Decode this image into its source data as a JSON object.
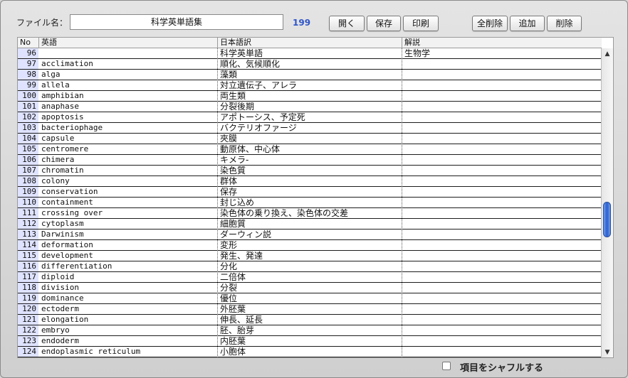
{
  "toolbar": {
    "file_label": "ファイル名：",
    "file_name": "科学英単語集",
    "count": "199",
    "open_label": "開く",
    "save_label": "保存",
    "print_label": "印刷",
    "delete_all_label": "全削除",
    "add_label": "追加",
    "delete_label": "削除"
  },
  "table": {
    "headers": {
      "no": "No",
      "en": "英語",
      "ja": "日本語訳",
      "ex": "解説"
    },
    "rows": [
      {
        "no": "96",
        "en": "",
        "ja": "科学英単語",
        "ex": "生物学"
      },
      {
        "no": "97",
        "en": "acclimation",
        "ja": "順化、気候順化",
        "ex": ""
      },
      {
        "no": "98",
        "en": "alga",
        "ja": "藻類",
        "ex": ""
      },
      {
        "no": "99",
        "en": "allela",
        "ja": "対立遺伝子、アレラ",
        "ex": ""
      },
      {
        "no": "100",
        "en": "amphibian",
        "ja": "両生類",
        "ex": ""
      },
      {
        "no": "101",
        "en": "anaphase",
        "ja": "分裂後期",
        "ex": ""
      },
      {
        "no": "102",
        "en": "apoptosis",
        "ja": "アポトーシス、予定死",
        "ex": ""
      },
      {
        "no": "103",
        "en": "bacteriophage",
        "ja": "バクテリオファージ",
        "ex": ""
      },
      {
        "no": "104",
        "en": "capsule",
        "ja": "夾膜",
        "ex": ""
      },
      {
        "no": "105",
        "en": "centromere",
        "ja": "動原体、中心体",
        "ex": ""
      },
      {
        "no": "106",
        "en": "chimera",
        "ja": "キメラ-",
        "ex": ""
      },
      {
        "no": "107",
        "en": "chromatin",
        "ja": "染色質",
        "ex": ""
      },
      {
        "no": "108",
        "en": "colony",
        "ja": "群体",
        "ex": ""
      },
      {
        "no": "109",
        "en": "conservation",
        "ja": "保存",
        "ex": ""
      },
      {
        "no": "110",
        "en": "containment",
        "ja": "封じ込め",
        "ex": ""
      },
      {
        "no": "111",
        "en": "crossing over",
        "ja": "染色体の乗り換え、染色体の交差",
        "ex": ""
      },
      {
        "no": "112",
        "en": "cytoplasm",
        "ja": "細胞質",
        "ex": ""
      },
      {
        "no": "113",
        "en": "Darwinism",
        "ja": "ダーウィン説",
        "ex": ""
      },
      {
        "no": "114",
        "en": "deformation",
        "ja": "変形",
        "ex": ""
      },
      {
        "no": "115",
        "en": "development",
        "ja": "発生、発達",
        "ex": ""
      },
      {
        "no": "116",
        "en": "differentiation",
        "ja": "分化",
        "ex": ""
      },
      {
        "no": "117",
        "en": "diploid",
        "ja": "二倍体",
        "ex": ""
      },
      {
        "no": "118",
        "en": "division",
        "ja": "分裂",
        "ex": ""
      },
      {
        "no": "119",
        "en": "dominance",
        "ja": "優位",
        "ex": ""
      },
      {
        "no": "120",
        "en": "ectoderm",
        "ja": "外胚葉",
        "ex": ""
      },
      {
        "no": "121",
        "en": "elongation",
        "ja": "伸長、延長",
        "ex": ""
      },
      {
        "no": "122",
        "en": "embryo",
        "ja": "胚、胎芽",
        "ex": ""
      },
      {
        "no": "123",
        "en": "endoderm",
        "ja": "内胚葉",
        "ex": ""
      },
      {
        "no": "124",
        "en": "endoplasmic reticulum",
        "ja": "小胞体",
        "ex": ""
      }
    ]
  },
  "scrollbar": {
    "up_icon": "triangle-up",
    "down_icon": "triangle-down"
  },
  "footer": {
    "shuffle_label": "項目をシャフルする"
  },
  "colors": {
    "no_column_bg": "#dfe3ff",
    "count_color": "#2f56c8",
    "thumb": "#2a5fd0"
  }
}
